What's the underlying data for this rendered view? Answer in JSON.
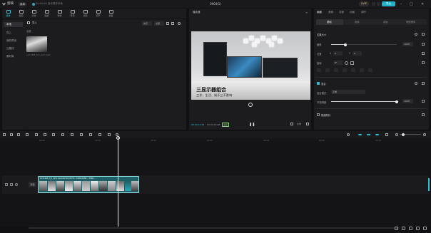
{
  "titlebar": {
    "app_name": "剪映",
    "menu_label": "菜单",
    "autosave": "00:00:00 自动保存本地",
    "project_title": "0904(1)",
    "pro_label": "SVIP",
    "export_label": "导出"
  },
  "toolbar": {
    "tools": [
      {
        "label": "媒体",
        "icon": "media-icon",
        "active": true
      },
      {
        "label": "音频",
        "icon": "audio-icon"
      },
      {
        "label": "文本",
        "icon": "text-icon"
      },
      {
        "label": "贴纸",
        "icon": "sticker-icon"
      },
      {
        "label": "特效",
        "icon": "effects-icon"
      },
      {
        "label": "转场",
        "icon": "transition-icon"
      },
      {
        "label": "滤镜",
        "icon": "filter-icon"
      },
      {
        "label": "调节",
        "icon": "adjust-icon"
      },
      {
        "label": "模板",
        "icon": "template-icon"
      }
    ]
  },
  "leftnav": {
    "items": [
      {
        "label": "本地",
        "active": true
      },
      {
        "label": "导入"
      },
      {
        "label": "我的预设"
      },
      {
        "label": "云素材"
      },
      {
        "label": "素材库"
      }
    ]
  },
  "media": {
    "import_label": "导入",
    "section_label": "全部",
    "sort_label": "排序",
    "filter_label": "全部",
    "thumb_label": "1171445_0_1_0(2).mp4"
  },
  "player": {
    "title": "播放器",
    "caption_main": "三显示器组合",
    "caption_sub": "工作、生活、娱乐三不影响",
    "time_current": "00:00:14:29",
    "time_total": "00:01:44:08",
    "badge": "适配",
    "ratio_label": "比例",
    "full_label": "全屏"
  },
  "props": {
    "tabs": [
      {
        "label": "画面",
        "active": true
      },
      {
        "label": "音频"
      },
      {
        "label": "变速"
      },
      {
        "label": "动画"
      },
      {
        "label": "调节"
      }
    ],
    "subtabs": [
      {
        "label": "基础",
        "active": true
      },
      {
        "label": "抠像"
      },
      {
        "label": "蒙版"
      },
      {
        "label": "美颜美体"
      }
    ],
    "section_position": "位置大小",
    "scale_label": "缩放",
    "scale_value": "100%",
    "scale_fraction": 0.22,
    "pos_label": "位置",
    "pos_x_label": "X",
    "pos_x": "0",
    "pos_y_label": "Y",
    "pos_y": "0",
    "rotate_label": "旋转",
    "rotate_value": "0°",
    "blend_section": "混合",
    "blend_mode_label": "混合模式",
    "blend_mode_value": "正常",
    "opacity_label": "不透明度",
    "opacity_value": "100%",
    "opacity_fraction": 1.0,
    "stabilize_section": "视频防抖"
  },
  "timeline": {
    "ticks": [
      "00:00",
      "00:10",
      "00:20",
      "00:30",
      "00:40",
      "00:50",
      "01:00"
    ],
    "cover_label": "封面",
    "clip_title": "1171445_0_1_0(2).mp4 00:01:44:08 • 1920x1080 • 30fps"
  }
}
